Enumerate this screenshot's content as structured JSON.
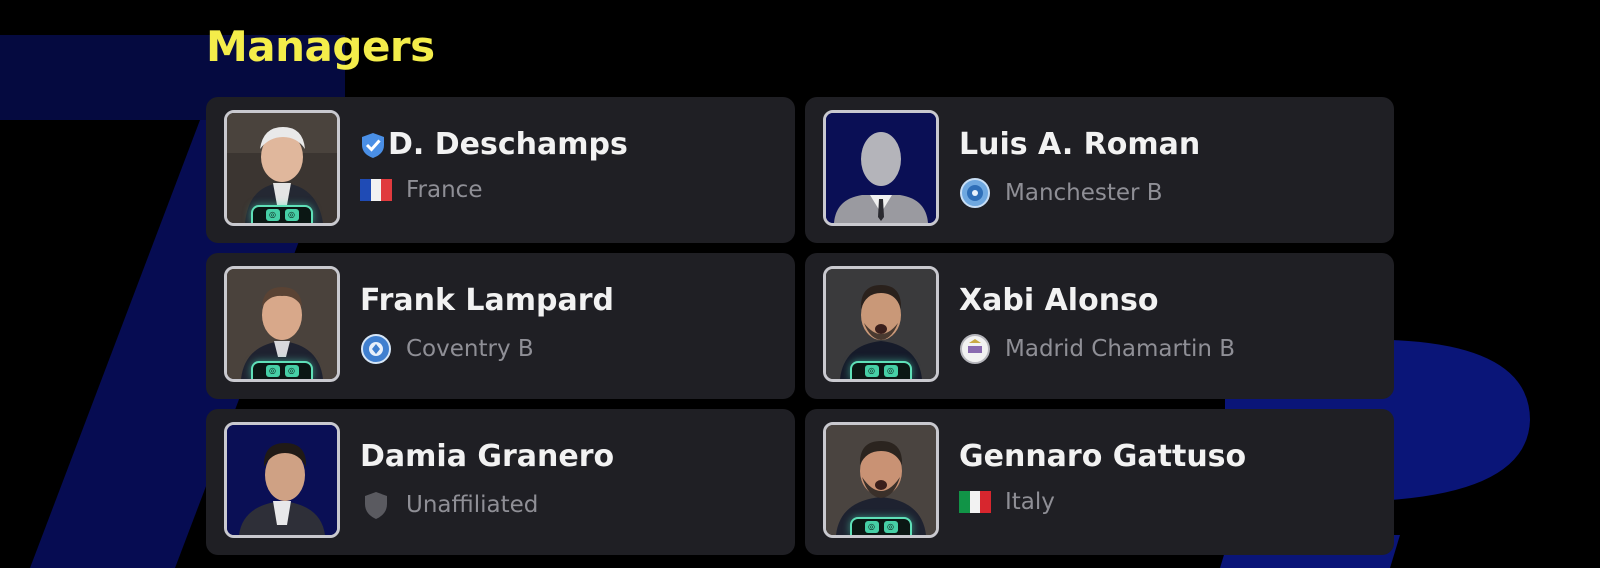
{
  "title": "Managers",
  "colors": {
    "title": "#f4ed4a",
    "card": "#1f1f24",
    "accent_teal": "#5fe0b8",
    "verified": "#4a8fe6"
  },
  "managers": [
    {
      "name": "D. Deschamps",
      "verified": true,
      "team": "France",
      "team_icon": "france-flag-icon",
      "portrait": "photo",
      "booster_badge": true
    },
    {
      "name": "Luis A. Roman",
      "verified": false,
      "team": "Manchester B",
      "team_icon": "manchester-b-emblem-icon",
      "portrait": "silhouette",
      "booster_badge": false
    },
    {
      "name": "Frank Lampard",
      "verified": false,
      "team": "Coventry B",
      "team_icon": "coventry-b-emblem-icon",
      "portrait": "photo",
      "booster_badge": true
    },
    {
      "name": "Xabi Alonso",
      "verified": false,
      "team": "Madrid Chamartin B",
      "team_icon": "madrid-chamartin-b-emblem-icon",
      "portrait": "photo",
      "booster_badge": true
    },
    {
      "name": "Damia Granero",
      "verified": false,
      "team": "Unaffiliated",
      "team_icon": "unaffiliated-shield-icon",
      "portrait": "illustration",
      "booster_badge": false
    },
    {
      "name": "Gennaro Gattuso",
      "verified": false,
      "team": "Italy",
      "team_icon": "italy-flag-icon",
      "portrait": "photo",
      "booster_badge": true
    }
  ]
}
